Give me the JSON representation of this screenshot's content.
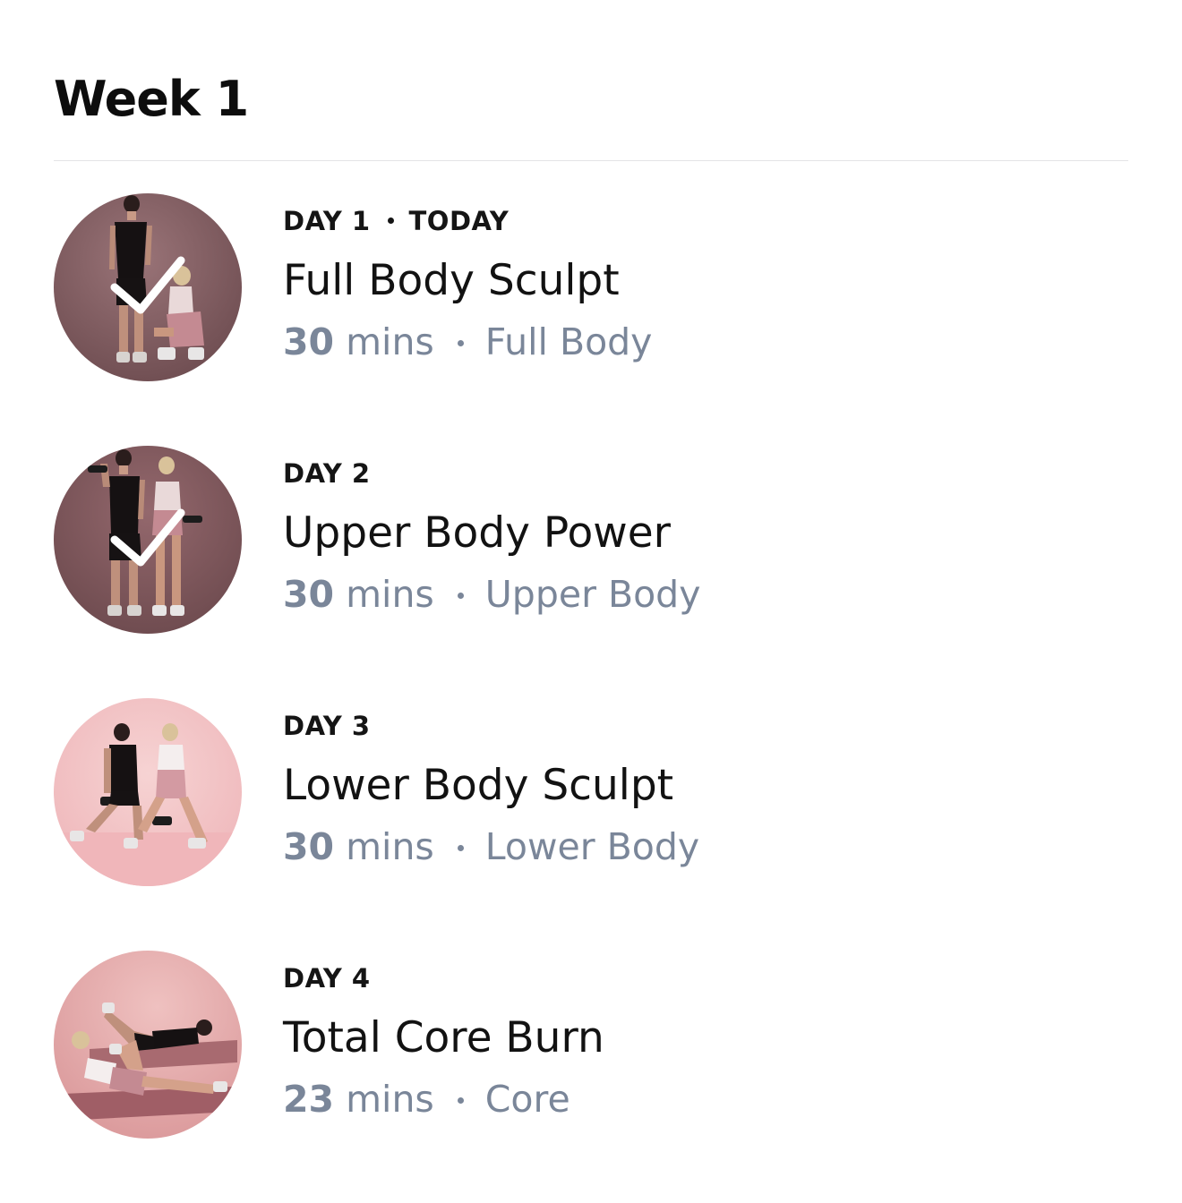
{
  "week": {
    "title": "Week 1"
  },
  "workouts": [
    {
      "day": "DAY 1",
      "badge": "TODAY",
      "title": "Full Body Sculpt",
      "duration_value": "30",
      "duration_unit": "mins",
      "category": "Full Body",
      "completed": true,
      "thumbnail": "dark-mauve-studio-pair-standing-crouching"
    },
    {
      "day": "DAY 2",
      "badge": "",
      "title": "Upper Body Power",
      "duration_value": "30",
      "duration_unit": "mins",
      "category": "Upper Body",
      "completed": true,
      "thumbnail": "dark-mauve-studio-pair-dumbbells"
    },
    {
      "day": "DAY 3",
      "badge": "",
      "title": "Lower Body Sculpt",
      "duration_value": "30",
      "duration_unit": "mins",
      "category": "Lower Body",
      "completed": false,
      "thumbnail": "pink-studio-pair-lunges"
    },
    {
      "day": "DAY 4",
      "badge": "",
      "title": "Total Core Burn",
      "duration_value": "23",
      "duration_unit": "mins",
      "category": "Core",
      "completed": false,
      "thumbnail": "pink-studio-pair-floor-crunches"
    }
  ],
  "colors": {
    "text_primary": "#121212",
    "text_secondary": "#7a8699",
    "divider": "#e3e3e6",
    "thumb_dark": "#7e5b5f",
    "thumb_pink": "#f2c4c6",
    "check": "#ffffff"
  },
  "icons": {
    "completed": "checkmark-icon",
    "separator": "dot-separator"
  }
}
